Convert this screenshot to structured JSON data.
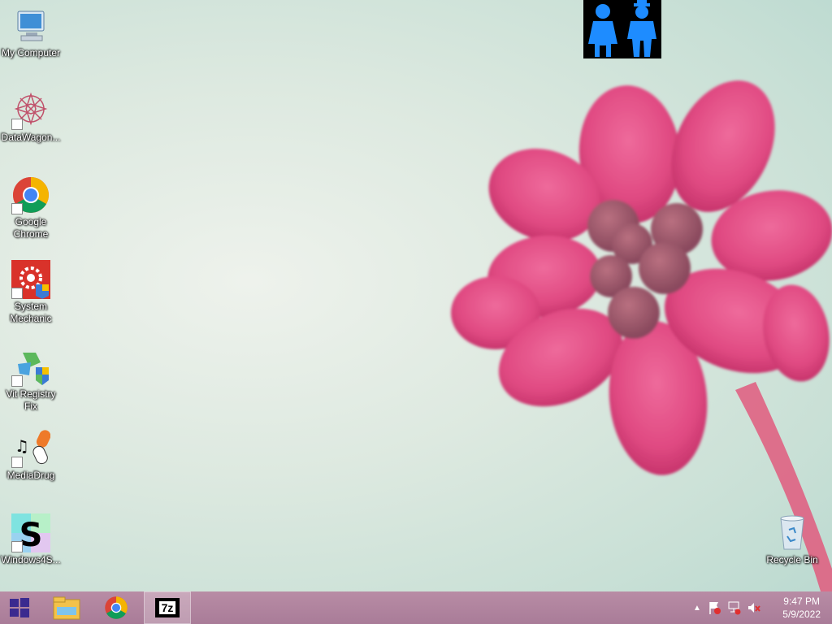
{
  "desktop": {
    "icons": [
      {
        "label": "My Computer"
      },
      {
        "label": "DataWagon..."
      },
      {
        "label": "Google Chrome"
      },
      {
        "label": "System Mechanic"
      },
      {
        "label": "Vit Registry Fix"
      },
      {
        "label": "MediaDrug"
      },
      {
        "label": "Windows4S..."
      },
      {
        "label": "Recycle Bin"
      }
    ]
  },
  "taskbar": {
    "pinned": [
      {
        "icon": "windows-start-icon"
      },
      {
        "icon": "file-explorer-icon"
      },
      {
        "icon": "chrome-icon"
      },
      {
        "icon": "7zip-icon",
        "text": "7z"
      }
    ],
    "tray_icons": [
      "chevron-up-icon",
      "action-center-flag-icon",
      "network-icon",
      "volume-muted-icon"
    ],
    "time": "9:47 PM",
    "date": "5/9/2022"
  },
  "colors": {
    "taskbar": "#b08aa3",
    "flower": "#e0457f",
    "wallpaper": "#d3e6dc"
  }
}
